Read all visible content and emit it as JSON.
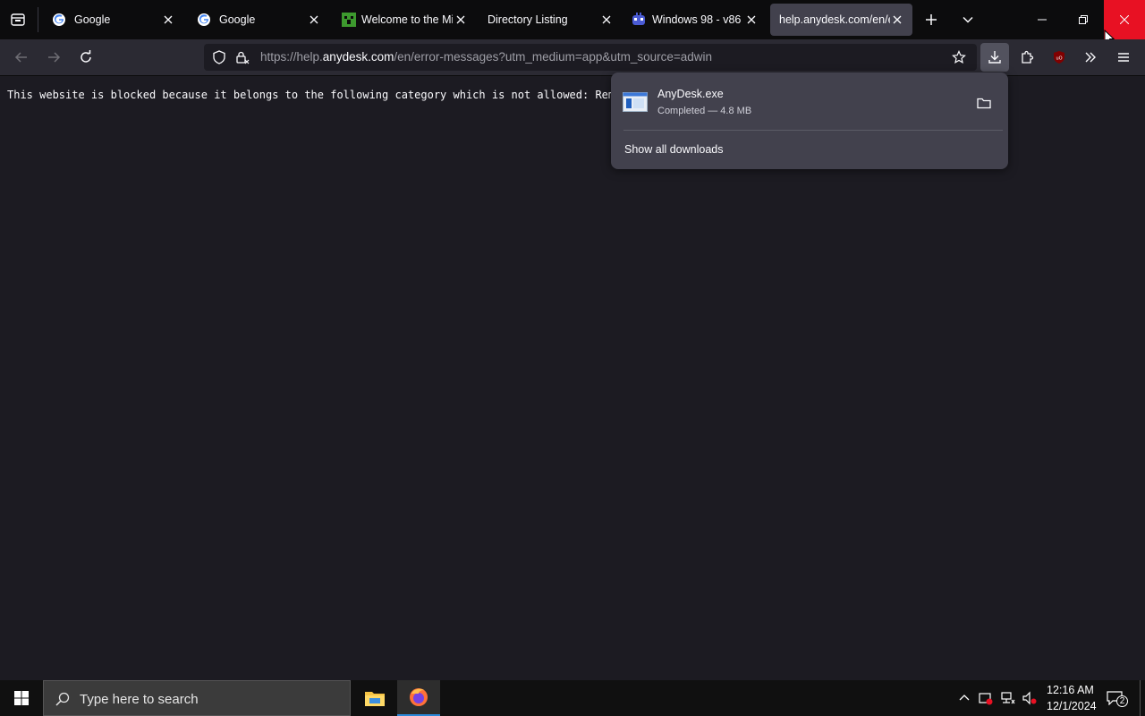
{
  "tabs": [
    {
      "title": "Google",
      "icon": "google-icon",
      "active": false
    },
    {
      "title": "Google",
      "icon": "google-icon",
      "active": false
    },
    {
      "title": "Welcome to the Mi",
      "icon": "minecraft-icon",
      "active": false
    },
    {
      "title": "Directory Listing",
      "icon": "",
      "active": false
    },
    {
      "title": "Windows 98 - v86",
      "icon": "v86-icon",
      "active": false
    },
    {
      "title": "help.anydesk.com/en/e",
      "icon": "",
      "active": true
    }
  ],
  "urlbar": {
    "url_prefix": "https://help.",
    "url_domain": "anydesk.com",
    "url_rest": "/en/error-messages?utm_medium=app&utm_source=adwin"
  },
  "page": {
    "blocked_message": "This website is blocked because it belongs to the following category which is not allowed: Remote"
  },
  "downloads_panel": {
    "file_name": "AnyDesk.exe",
    "status": "Completed — 4.8 MB",
    "show_all": "Show all downloads"
  },
  "taskbar": {
    "search_placeholder": "Type here to search",
    "time": "12:16 AM",
    "date": "12/1/2024",
    "notification_count": "2"
  },
  "colors": {
    "accent_red": "#e81123",
    "taskbar_active": "#2b88d8"
  }
}
